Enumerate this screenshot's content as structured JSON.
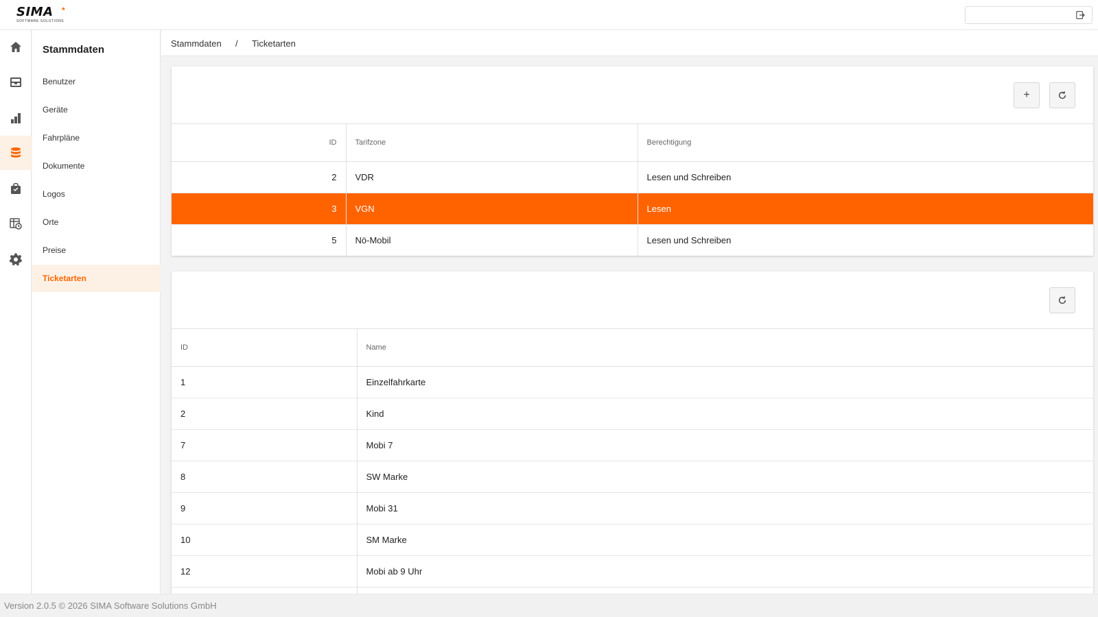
{
  "colors": {
    "accent": "#ff6600",
    "selected_row": "#ff6300",
    "active_bg": "#fdf1e6"
  },
  "logo": {
    "name": "SIMA",
    "tagline": "SOFTWARE SOLUTIONS"
  },
  "topbar": {
    "search_placeholder": "",
    "search_icon": "logout-icon"
  },
  "rail": {
    "items": [
      {
        "icon": "home-icon"
      },
      {
        "icon": "inbox-icon"
      },
      {
        "icon": "bar-chart-icon"
      },
      {
        "icon": "database-icon",
        "active": true
      },
      {
        "icon": "shopping-bag-icon"
      },
      {
        "icon": "table-clock-icon"
      },
      {
        "icon": "gear-icon"
      }
    ]
  },
  "subnav": {
    "title": "Stammdaten",
    "items": [
      {
        "label": "Benutzer"
      },
      {
        "label": "Geräte"
      },
      {
        "label": "Fahrpläne"
      },
      {
        "label": "Dokumente"
      },
      {
        "label": "Logos"
      },
      {
        "label": "Orte"
      },
      {
        "label": "Preise"
      },
      {
        "label": "Ticketarten",
        "active": true
      }
    ]
  },
  "breadcrumb": {
    "root": "Stammdaten",
    "separator": "/",
    "current": "Ticketarten"
  },
  "zones_table": {
    "add_label": "+",
    "columns": {
      "id": "ID",
      "zone": "Tarifzone",
      "permission": "Berechtigung"
    },
    "rows": [
      {
        "id": "2",
        "zone": "VDR",
        "permission": "Lesen und Schreiben"
      },
      {
        "id": "3",
        "zone": "VGN",
        "permission": "Lesen",
        "selected": true
      },
      {
        "id": "5",
        "zone": "Nö-Mobil",
        "permission": "Lesen und Schreiben"
      }
    ]
  },
  "tickets_table": {
    "columns": {
      "id": "ID",
      "name": "Name"
    },
    "rows": [
      {
        "id": "1",
        "name": "Einzelfahrkarte"
      },
      {
        "id": "2",
        "name": "Kind"
      },
      {
        "id": "7",
        "name": "Mobi 7"
      },
      {
        "id": "8",
        "name": "SW Marke"
      },
      {
        "id": "9",
        "name": "Mobi 31"
      },
      {
        "id": "10",
        "name": "SM Marke"
      },
      {
        "id": "12",
        "name": "Mobi ab 9 Uhr"
      }
    ]
  },
  "footer": {
    "text": "Version 2.0.5 © 2026 SIMA Software Solutions GmbH"
  }
}
